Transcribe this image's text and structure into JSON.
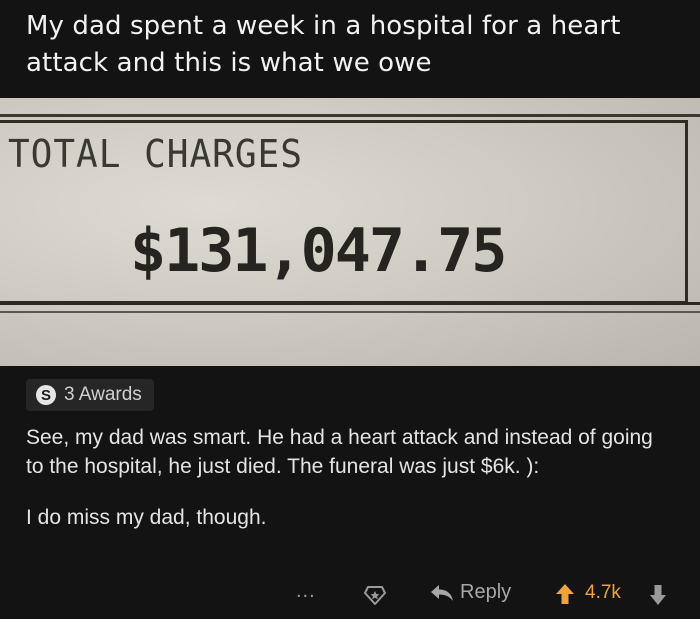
{
  "post": {
    "title": "My dad spent a week in a hospital for a heart attack and this is what we owe"
  },
  "bill": {
    "label": "TOTAL CHARGES",
    "amount": "$131,047.75"
  },
  "awards": {
    "icon_letter": "S",
    "label": "3 Awards"
  },
  "comment": {
    "paragraph_1": "See, my dad was smart. He had a heart attack and instead of going to the hospital, he just died. The funeral was just $6k. ):",
    "paragraph_2": "I do miss my dad, though."
  },
  "actions": {
    "more": "...",
    "reply_label": "Reply",
    "score": "4.7k",
    "score_color": "#f0a23c"
  }
}
